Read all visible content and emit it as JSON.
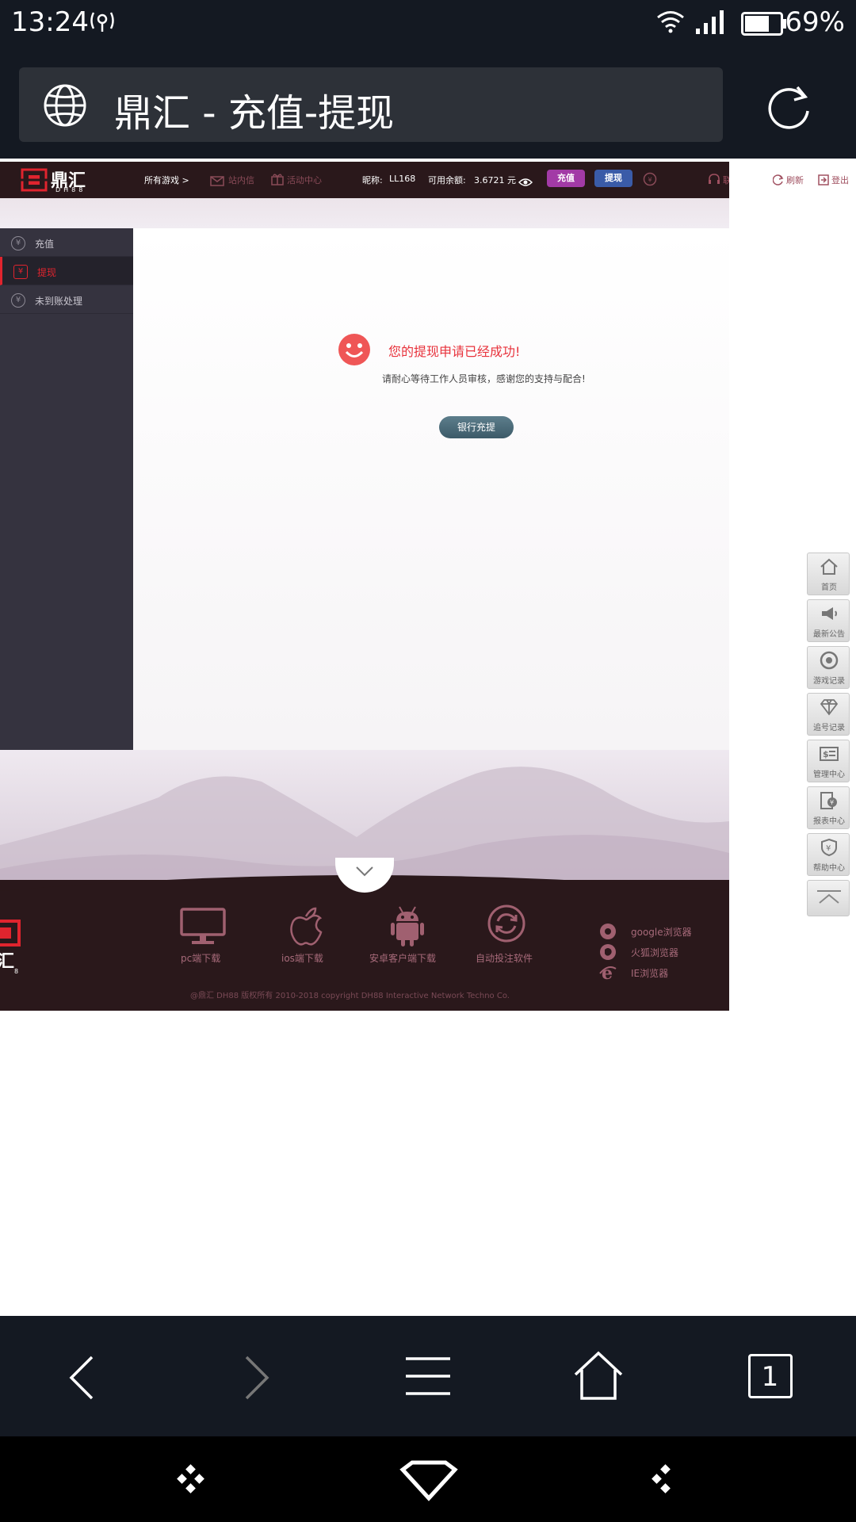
{
  "status_bar": {
    "time": "13:24",
    "battery_percent": "69%",
    "battery_level": 0.69
  },
  "url_bar": {
    "title": "鼎汇 - 充值-提现"
  },
  "site": {
    "logo_text": "鼎汇",
    "logo_sub": "DH88",
    "header": {
      "all_games": "所有游戏 >",
      "inbox": "站内信",
      "activity": "活动中心",
      "nickname_label": "昵称:",
      "nickname": "LL168",
      "balance_label": "可用余额:",
      "balance": "3.6721 元",
      "recharge_button": "充值",
      "withdraw_button": "提现",
      "contact": "联系客服",
      "refresh": "刷新",
      "logout": "登出"
    },
    "sidebar": {
      "items": [
        {
          "label": "充值",
          "icon": "yen-circle-icon"
        },
        {
          "label": "提现",
          "icon": "yen-shield-icon"
        },
        {
          "label": "未到账处理",
          "icon": "yen-clock-icon"
        }
      ]
    },
    "main": {
      "success_title": "您的提现申请已经成功!",
      "success_message": "请耐心等待工作人员审核，感谢您的支持与配合!",
      "bank_recharge_button": "银行充提"
    },
    "float_nav": [
      {
        "label": "首页",
        "icon": "home-icon"
      },
      {
        "label": "最新公告",
        "icon": "megaphone-icon"
      },
      {
        "label": "游戏记录",
        "icon": "game-record-icon"
      },
      {
        "label": "追号记录",
        "icon": "diamond-icon"
      },
      {
        "label": "管理中心",
        "icon": "dollar-card-icon"
      },
      {
        "label": "报表中心",
        "icon": "report-icon"
      },
      {
        "label": "帮助中心",
        "icon": "help-shield-icon"
      },
      {
        "label": "",
        "icon": "scroll-top-icon"
      }
    ],
    "footer": {
      "downloads": [
        {
          "label": "pc端下载",
          "icon": "monitor-icon"
        },
        {
          "label": "ios端下载",
          "icon": "apple-icon"
        },
        {
          "label": "安卓客户端下载",
          "icon": "android-icon"
        },
        {
          "label": "自动投注软件",
          "icon": "refresh-circle-icon"
        }
      ],
      "browsers": [
        {
          "label": "google浏览器",
          "icon": "chrome-icon"
        },
        {
          "label": "火狐浏览器",
          "icon": "firefox-icon"
        },
        {
          "label": "IE浏览器",
          "icon": "ie-icon"
        }
      ],
      "copyright": "@鼎汇 DH88 版权所有 2010-2018 copyright DH88 Interactive Network Techno Co."
    }
  },
  "browser_nav": {
    "tab_count": "1"
  },
  "colors": {
    "bar_bg": "#141922",
    "site_header": "#2a181b",
    "accent_red": "#e8323c",
    "recharge_pill": "#a23aa6",
    "withdraw_pill": "#3a5ba8",
    "bank_button": "#4a6b7a"
  }
}
